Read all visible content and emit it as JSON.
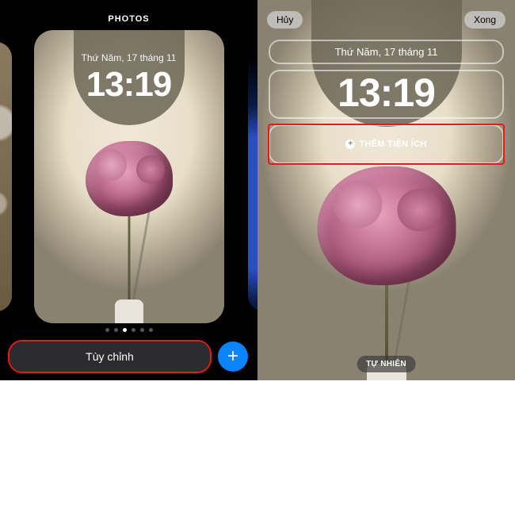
{
  "left": {
    "header": "PHOTOS",
    "date": "Thứ Năm, 17 tháng 11",
    "time": "13:19",
    "customize_label": "Tùy chỉnh",
    "add_label": "+"
  },
  "right": {
    "cancel_label": "Hủy",
    "done_label": "Xong",
    "date": "Thứ Năm, 17 tháng 11",
    "time": "13:19",
    "add_widget_label": "THÊM TIỆN ÍCH",
    "filter_label": "TỰ NHIÊN"
  }
}
